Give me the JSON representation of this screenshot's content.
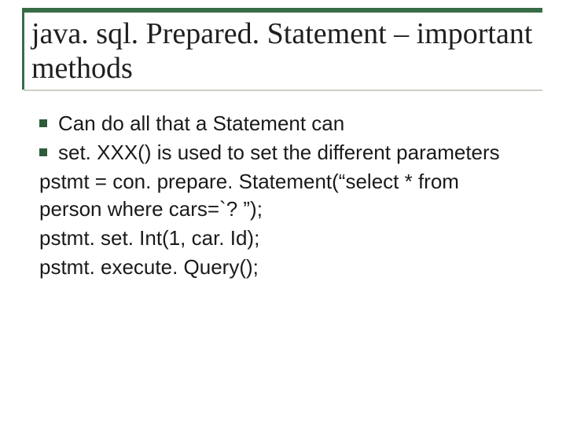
{
  "title": {
    "line1": "java. sql. Prepared. Statement – important",
    "line2": "methods"
  },
  "bullets": [
    "Can do all that a Statement can",
    "set. XXX() is used to set the different parameters"
  ],
  "lines": [
    "pstmt = con. prepare. Statement(“select * from person where cars=`? ”);",
    "pstmt. set. Int(1, car. Id);",
    "pstmt. execute. Query();"
  ]
}
